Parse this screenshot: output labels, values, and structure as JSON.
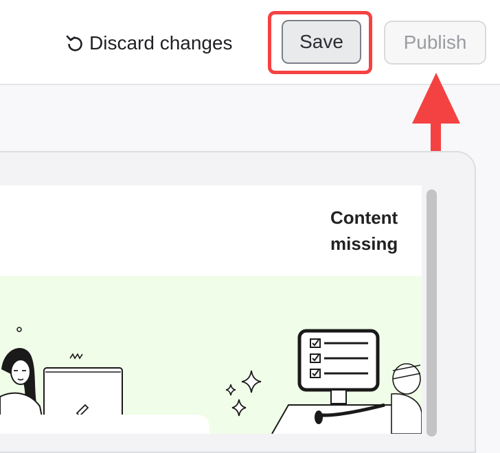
{
  "toolbar": {
    "discard_label": "Discard changes",
    "discard_icon": "undo-icon",
    "save_label": "Save",
    "publish_label": "Publish"
  },
  "annotation": {
    "highlight_color": "#f44242",
    "arrow_color": "#f44242"
  },
  "card": {
    "status": "Content missing"
  },
  "colors": {
    "illustration_bg": "#f0fde8",
    "topbar_bg": "#ffffff",
    "page_bg": "#f8f8fa"
  }
}
